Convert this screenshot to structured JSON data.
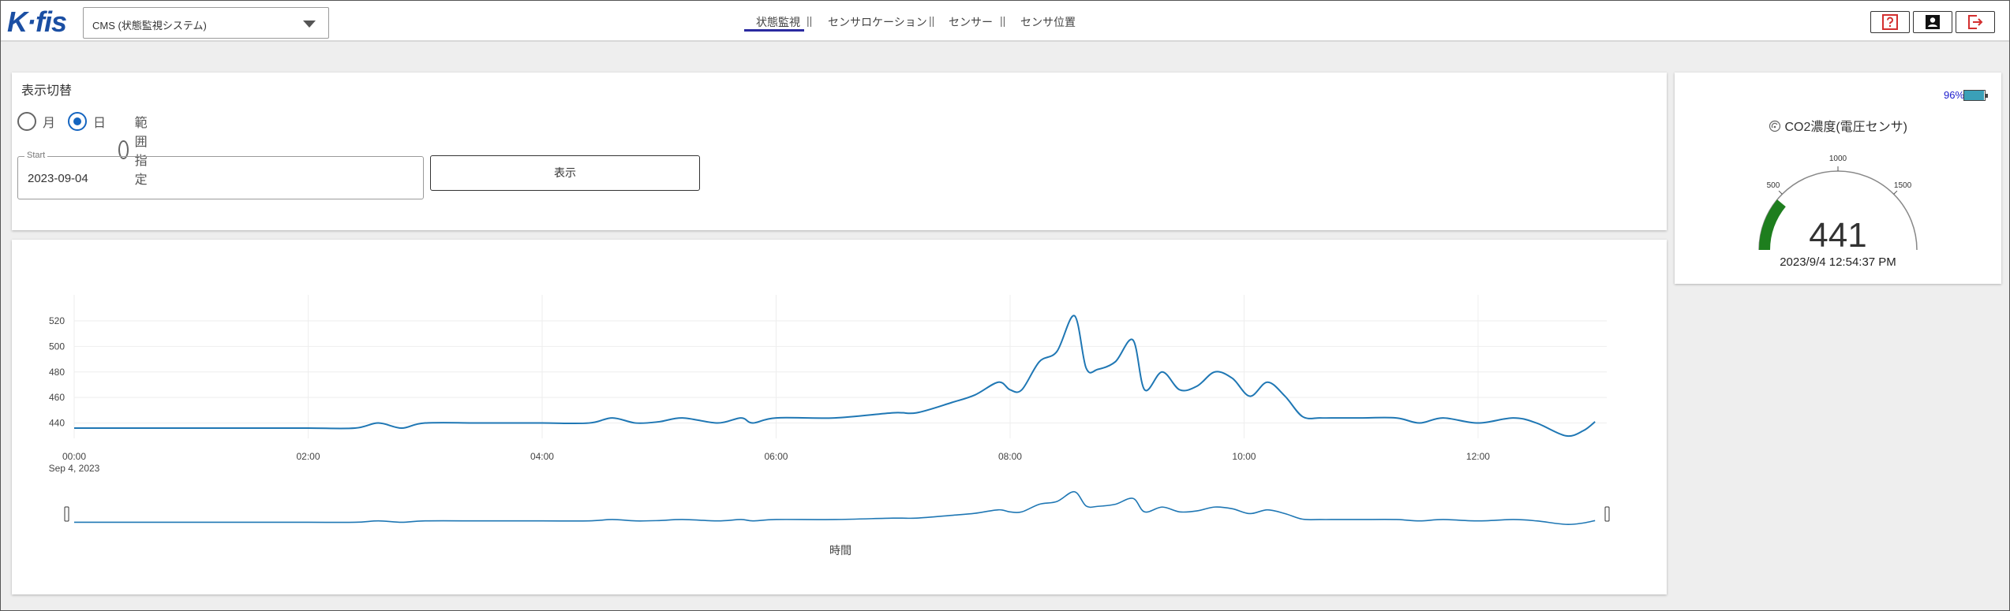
{
  "app": {
    "logo": "K·fis",
    "system_select": "CMS (状態監視システム)"
  },
  "nav": {
    "items": [
      "状態監視",
      "センサロケーション",
      "センサー",
      "センサ位置"
    ],
    "separator": "||",
    "active": "状態監視"
  },
  "header_buttons": {
    "help": "help-icon",
    "user": "user-icon",
    "logout": "logout-icon"
  },
  "controls": {
    "title": "表示切替",
    "radios": [
      {
        "label": "月",
        "checked": false
      },
      {
        "label": "日",
        "checked": true
      },
      {
        "label": "範囲指定",
        "checked": false
      }
    ],
    "start_label": "Start",
    "start_value": "2023-09-04",
    "show_button": "表示"
  },
  "gauge": {
    "battery_text": "96%",
    "battery_level": 0.96,
    "title": "CO2濃度(電圧センサ)",
    "title_icon": "sensor-icon",
    "value": "441",
    "min": 0,
    "max": 2000,
    "ticks": [
      "500",
      "1000",
      "1500"
    ],
    "timestamp": "2023/9/4 12:54:37 PM",
    "color": "#1e7e1e"
  },
  "chart_data": {
    "type": "line",
    "xlabel": "時間",
    "date_label": "Sep 4, 2023",
    "x_ticks": [
      "00:00",
      "02:00",
      "04:00",
      "06:00",
      "08:00",
      "10:00",
      "12:00"
    ],
    "y_ticks": [
      440,
      460,
      480,
      500,
      520
    ],
    "ylim": [
      428,
      528
    ],
    "xlim_hours": [
      0,
      13.1
    ],
    "line_color": "#1f77b4",
    "grid": true,
    "range_slider": true,
    "series": [
      {
        "x": [
          0,
          0.5,
          1,
          1.5,
          2,
          2.4,
          2.6,
          2.8,
          3,
          3.5,
          4,
          4.4,
          4.6,
          4.8,
          5,
          5.2,
          5.5,
          5.7,
          5.8,
          6,
          6.5,
          7,
          7.2,
          7.5,
          7.7,
          7.9,
          8.0,
          8.1,
          8.25,
          8.4,
          8.55,
          8.65,
          8.75,
          8.9,
          9.05,
          9.15,
          9.3,
          9.45,
          9.6,
          9.75,
          9.9,
          10.05,
          10.2,
          10.35,
          10.5,
          10.65,
          10.8,
          11.0,
          11.3,
          11.5,
          11.7,
          12.0,
          12.3,
          12.5,
          12.75,
          12.9,
          13.0
        ],
        "y": [
          436,
          436,
          436,
          436,
          436,
          436,
          440,
          436,
          440,
          440,
          440,
          440,
          444,
          440,
          441,
          444,
          440,
          444,
          440,
          444,
          444,
          448,
          448,
          456,
          462,
          472,
          466,
          466,
          488,
          496,
          524,
          483,
          482,
          488,
          505,
          466,
          480,
          466,
          469,
          480,
          475,
          461,
          472,
          461,
          445,
          444,
          444,
          444,
          444,
          440,
          444,
          440,
          444,
          440,
          430,
          434,
          441
        ]
      }
    ]
  }
}
